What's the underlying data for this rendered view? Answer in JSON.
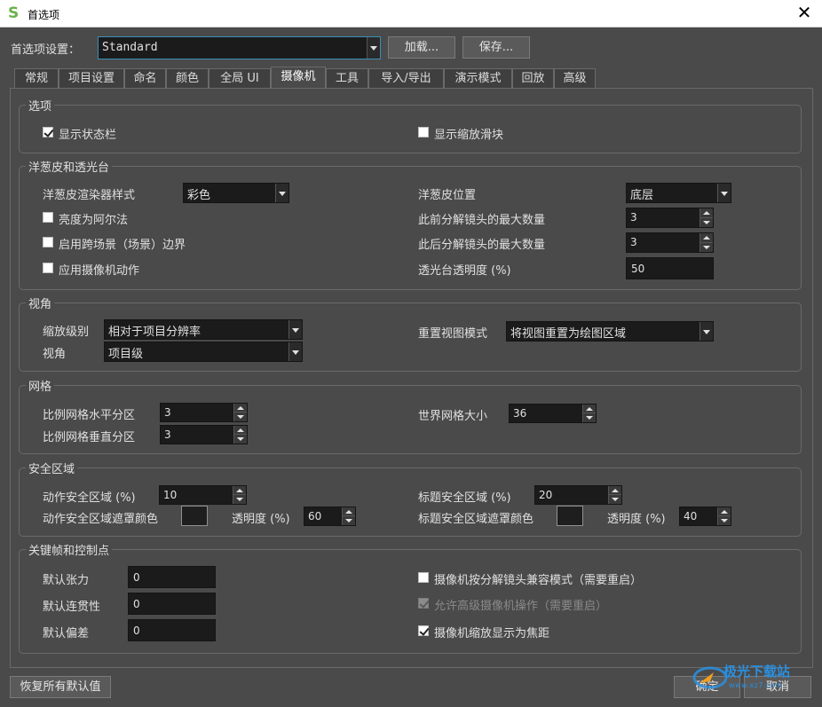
{
  "window": {
    "title": "首选项",
    "app_icon_letter": "S",
    "close_glyph": "✕"
  },
  "top": {
    "prefs_label": "首选项设置：",
    "prefs_value": "Standard",
    "load_button": "加载...",
    "save_button": "保存..."
  },
  "tabs": [
    {
      "label": "常规",
      "active": false
    },
    {
      "label": "项目设置",
      "active": false
    },
    {
      "label": "命名",
      "active": false
    },
    {
      "label": "颜色",
      "active": false
    },
    {
      "label": "全局 UI",
      "active": false
    },
    {
      "label": "摄像机",
      "active": true
    },
    {
      "label": "工具",
      "active": false
    },
    {
      "label": "导入/导出",
      "active": false
    },
    {
      "label": "演示模式",
      "active": false
    },
    {
      "label": "回放",
      "active": false
    },
    {
      "label": "高级",
      "active": false
    }
  ],
  "options": {
    "title": "选项",
    "show_status_bar": {
      "label": "显示状态栏",
      "checked": true
    },
    "show_zoom_slider": {
      "label": "显示缩放滑块",
      "checked": false
    }
  },
  "onion": {
    "title": "洋葱皮和透光台",
    "renderer_label": "洋葱皮渲染器样式",
    "renderer_value": "彩色",
    "position_label": "洋葱皮位置",
    "position_value": "底层",
    "luma_alpha": {
      "label": "亮度为阿尔法",
      "checked": false
    },
    "cross_scene": {
      "label": "启用跨场景（场景）边界",
      "checked": false
    },
    "apply_camera": {
      "label": "应用摄像机动作",
      "checked": false
    },
    "max_prev_label": "此前分解镜头的最大数量",
    "max_prev_value": "3",
    "max_next_label": "此后分解镜头的最大数量",
    "max_next_value": "3",
    "lighttable_label": "透光台透明度 (%)",
    "lighttable_value": "50"
  },
  "view": {
    "title": "视角",
    "zoom_label": "缩放级别",
    "zoom_value": "相对于项目分辨率",
    "view_label": "视角",
    "view_value": "项目级",
    "reset_label": "重置视图模式",
    "reset_value": "将视图重置为绘图区域"
  },
  "grid": {
    "title": "网格",
    "h_label": "比例网格水平分区",
    "h_value": "3",
    "v_label": "比例网格垂直分区",
    "v_value": "3",
    "world_label": "世界网格大小",
    "world_value": "36"
  },
  "safe": {
    "title": "安全区域",
    "action_label": "动作安全区域 (%)",
    "action_value": "10",
    "action_mask_label": "动作安全区域遮罩颜色",
    "action_opacity_label": "透明度 (%)",
    "action_opacity_value": "60",
    "title_label": "标题安全区域 (%)",
    "title_value": "20",
    "title_mask_label": "标题安全区域遮罩颜色",
    "title_opacity_label": "透明度 (%)",
    "title_opacity_value": "40",
    "mask_color": "#1e1e1e"
  },
  "keys": {
    "title": "关键帧和控制点",
    "tension_label": "默认张力",
    "tension_value": "0",
    "continuity_label": "默认连贯性",
    "continuity_value": "0",
    "bias_label": "默认偏差",
    "bias_value": "0",
    "compat": {
      "label": "摄像机按分解镜头兼容模式（需要重启）",
      "checked": false
    },
    "advanced": {
      "label": "允许高级摄像机操作（需要重启）",
      "checked": true,
      "disabled": true
    },
    "focal": {
      "label": "摄像机缩放显示为焦距",
      "checked": true
    }
  },
  "footer": {
    "restore_button": "恢复所有默认值",
    "ok_button": "确定",
    "cancel_button": "取消"
  },
  "watermark": {
    "text": "极光下载站",
    "url": "www.xz7.com"
  },
  "colors": {
    "background": "#4a4a4a",
    "field": "#1b1b1b",
    "accent": "#2b8fde"
  }
}
